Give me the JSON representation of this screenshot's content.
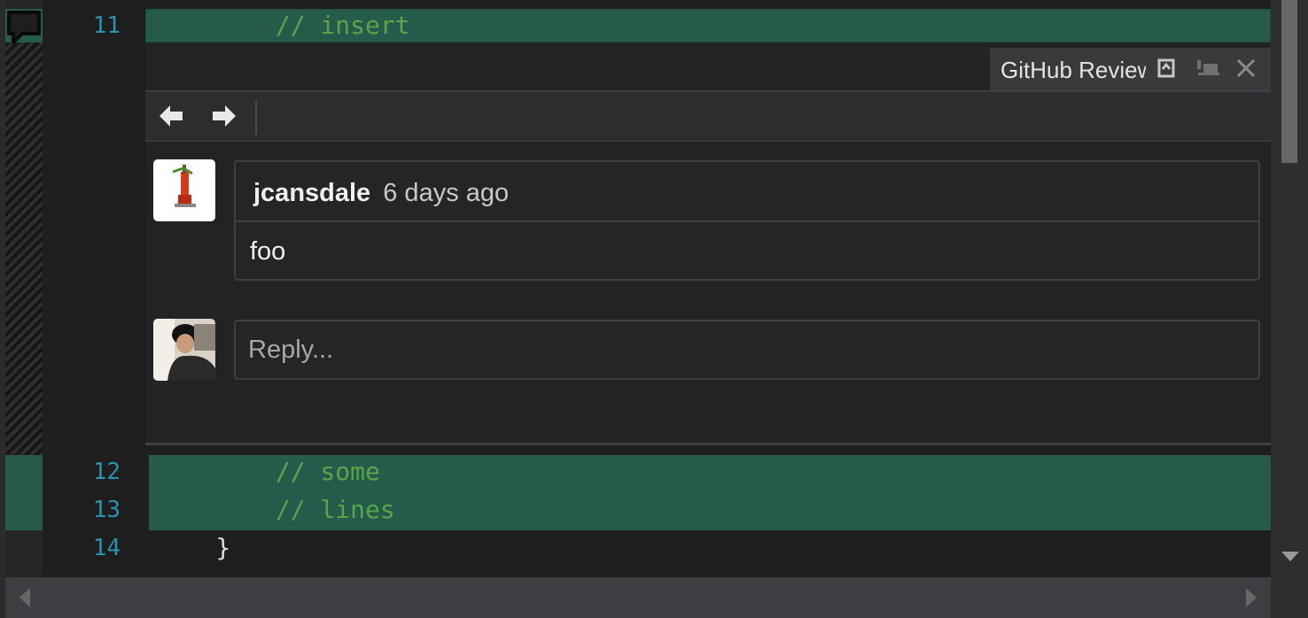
{
  "editor": {
    "lines": [
      {
        "number": "11",
        "text": "        // insert",
        "kind": "added"
      },
      {
        "number": "12",
        "text": "        // some",
        "kind": "added"
      },
      {
        "number": "13",
        "text": "        // lines",
        "kind": "added"
      },
      {
        "number": "14",
        "text": "    }",
        "kind": "normal"
      }
    ]
  },
  "peek": {
    "tab_title": "GitHub Review",
    "comments": [
      {
        "author": "jcansdale",
        "time": "6 days ago",
        "body": "foo"
      }
    ],
    "reply": {
      "placeholder": "Reply..."
    }
  },
  "colors": {
    "added_background": "#265a4a",
    "comment_text": "#57a64a",
    "line_number": "#2b91af",
    "editor_background": "#1e1e1e"
  },
  "icons": {
    "margin_glyph": "comment-icon",
    "nav_prev": "arrow-left-icon",
    "nav_next": "arrow-right-icon",
    "tab_promote": "promote-icon",
    "tab_pin": "pin-icon",
    "tab_close": "close-icon"
  }
}
